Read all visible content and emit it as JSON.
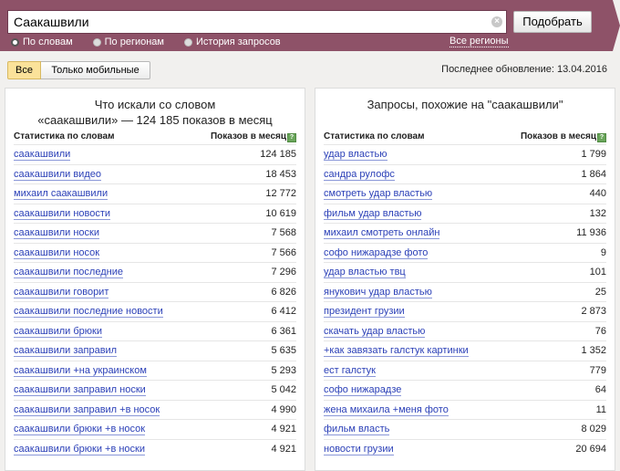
{
  "search": {
    "value": "Саакашвили",
    "button": "Подобрать",
    "modes": [
      "По словам",
      "По регионам",
      "История запросов"
    ],
    "regions_link": "Все регионы"
  },
  "filter": {
    "all": "Все",
    "mobile": "Только мобильные"
  },
  "updated": "Последнее обновление: 13.04.2016",
  "left": {
    "title_line1": "Что искали со словом",
    "title_line2": "«саакашвили» — 124 185 показов в месяц",
    "col_query": "Статистика по словам",
    "col_count": "Показов в месяц",
    "rows": [
      {
        "q": "саакашвили",
        "n": "124 185"
      },
      {
        "q": "саакашвили видео",
        "n": "18 453"
      },
      {
        "q": "михаил саакашвили",
        "n": "12 772"
      },
      {
        "q": "саакашвили новости",
        "n": "10 619"
      },
      {
        "q": "саакашвили носки",
        "n": "7 568"
      },
      {
        "q": "саакашвили носок",
        "n": "7 566"
      },
      {
        "q": "саакашвили последние",
        "n": "7 296"
      },
      {
        "q": "саакашвили говорит",
        "n": "6 826"
      },
      {
        "q": "саакашвили последние новости",
        "n": "6 412"
      },
      {
        "q": "саакашвили брюки",
        "n": "6 361"
      },
      {
        "q": "саакашвили заправил",
        "n": "5 635"
      },
      {
        "q": "саакашвили +на украинском",
        "n": "5 293"
      },
      {
        "q": "саакашвили заправил носки",
        "n": "5 042"
      },
      {
        "q": "саакашвили заправил +в носок",
        "n": "4 990"
      },
      {
        "q": "саакашвили брюки +в носок",
        "n": "4 921"
      },
      {
        "q": "саакашвили брюки +в носки",
        "n": "4 921"
      }
    ]
  },
  "right": {
    "title_line1": "Запросы, похожие на \"саакашвили\"",
    "col_query": "Статистика по словам",
    "col_count": "Показов в месяц",
    "rows": [
      {
        "q": "удар властью",
        "n": "1 799"
      },
      {
        "q": "сандра рулофс",
        "n": "1 864"
      },
      {
        "q": "смотреть удар властью",
        "n": "440"
      },
      {
        "q": "фильм удар властью",
        "n": "132"
      },
      {
        "q": "михаил смотреть онлайн",
        "n": "11 936"
      },
      {
        "q": "софо нижарадзе фото",
        "n": "9"
      },
      {
        "q": "удар властью твц",
        "n": "101"
      },
      {
        "q": "янукович удар властью",
        "n": "25"
      },
      {
        "q": "президент грузии",
        "n": "2 873"
      },
      {
        "q": "скачать удар властью",
        "n": "76"
      },
      {
        "q": "+как завязать галстук картинки",
        "n": "1 352"
      },
      {
        "q": "ест галстук",
        "n": "779"
      },
      {
        "q": "софо нижарадзе",
        "n": "64"
      },
      {
        "q": "жена михаила +меня фото",
        "n": "11"
      },
      {
        "q": "фильм власть",
        "n": "8 029"
      },
      {
        "q": "новости грузии",
        "n": "20 694"
      }
    ]
  },
  "colors": {
    "header": "#8e5268",
    "link": "#2a3fb7",
    "active_filter": "#fbe29a"
  }
}
